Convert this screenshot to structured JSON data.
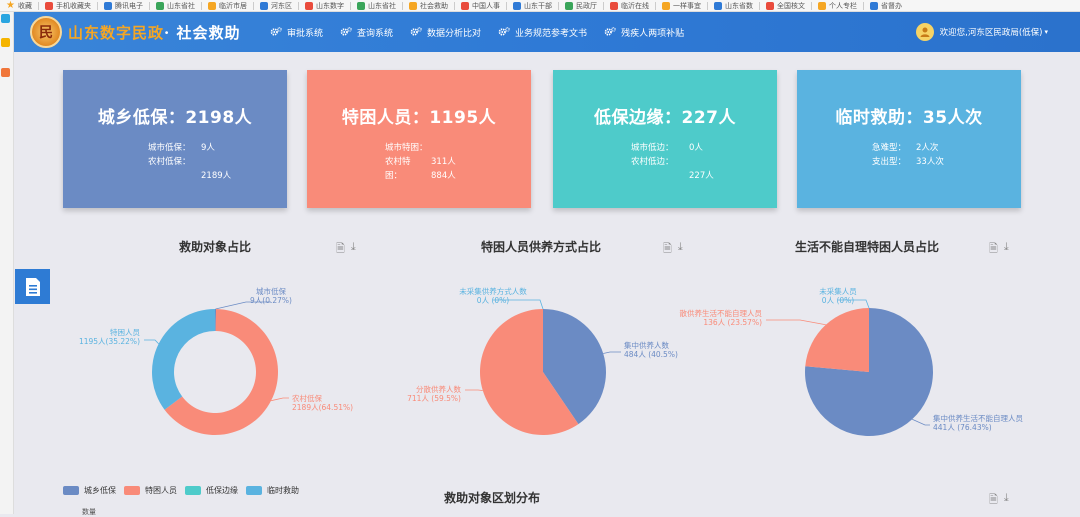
{
  "bookmarks": [
    "收藏",
    "手机收藏夹",
    "腾讯电子",
    "山东省社",
    "临沂市居",
    "河东区",
    "山东数字",
    "山东省社",
    "社会救助",
    "中国人事",
    "山东干部",
    "民政厅",
    "临沂在线",
    "一样事宜",
    "山东省数",
    "全国核文",
    "个人专栏",
    "省督办"
  ],
  "header": {
    "logo_char": "民",
    "brand": "山东数字民政",
    "brand_sub": "· 社会救助",
    "nav": [
      "审批系统",
      "查询系统",
      "数据分析比对",
      "业务规范参考文书",
      "残疾人两项补贴"
    ],
    "user": "欢迎您,河东区民政局(低保)"
  },
  "cards": [
    {
      "title": "城乡低保：2198人",
      "lines": [
        [
          "城市低保：",
          "9人"
        ],
        [
          "农村低保：",
          ""
        ],
        [
          "",
          "2189人"
        ]
      ]
    },
    {
      "title": "特困人员：1195人",
      "lines": [
        [
          "城市特困：",
          ""
        ],
        [
          "农村特",
          "311人"
        ],
        [
          "困：",
          "884人"
        ]
      ]
    },
    {
      "title": "低保边缘：227人",
      "lines": [
        [
          "城市低边：",
          "0人"
        ],
        [
          "农村低边：",
          ""
        ],
        [
          "",
          "227人"
        ]
      ]
    },
    {
      "title": "临时救助：35人次",
      "lines": [
        [
          "急难型：",
          "2人次"
        ],
        [
          "支出型：",
          "33人次"
        ]
      ]
    }
  ],
  "sections": {
    "s1": "救助对象占比",
    "s2": "特困人员供养方式占比",
    "s3": "生活不能自理特困人员占比",
    "s4": "救助对象区划分布"
  },
  "legend": [
    {
      "name": "城乡低保",
      "color": "#6b8bc4"
    },
    {
      "name": "特困人员",
      "color": "#f98b79"
    },
    {
      "name": "低保边缘",
      "color": "#4ecbca"
    },
    {
      "name": "临时救助",
      "color": "#5ab3e0"
    }
  ],
  "bottom_stub": "数量",
  "chart_data": [
    {
      "type": "pie",
      "title": "救助对象占比",
      "donut": true,
      "slices": [
        {
          "label": "城市低保",
          "value": 9,
          "percent": "0.27%",
          "color": "#6b8bc4",
          "text1": "城市低保",
          "text2": "9人(0.27%)"
        },
        {
          "label": "农村低保",
          "value": 2189,
          "percent": "64.51%",
          "color": "#f98b79",
          "text1": "农村低保",
          "text2": "2189人(64.51%)"
        },
        {
          "label": "特困人员",
          "value": 1195,
          "percent": "35.22%",
          "color": "#5ab3e0",
          "text1": "特困人员",
          "text2": "1195人(35.22%)"
        }
      ]
    },
    {
      "type": "pie",
      "title": "特困人员供养方式占比",
      "donut": false,
      "slices": [
        {
          "label": "未采集供养方式人数",
          "value": 0,
          "percent": "0%",
          "color": "#5ab3e0",
          "text1": "未采集供养方式人数",
          "text2": "0人 (0%)"
        },
        {
          "label": "集中供养人数",
          "value": 484,
          "percent": "40.5%",
          "color": "#6b8bc4",
          "text1": "集中供养人数",
          "text2": "484人 (40.5%)"
        },
        {
          "label": "分散供养人数",
          "value": 711,
          "percent": "59.5%",
          "color": "#f98b79",
          "text1": "分散供养人数",
          "text2": "711人 (59.5%)"
        }
      ]
    },
    {
      "type": "pie",
      "title": "生活不能自理特困人员占比",
      "donut": false,
      "slices": [
        {
          "label": "未采集人员",
          "value": 0,
          "percent": "0%",
          "color": "#5ab3e0",
          "text1": "未采集人员",
          "text2": "0人 (0%)"
        },
        {
          "label": "集中供养生活不能自理人员",
          "value": 441,
          "percent": "76.43%",
          "color": "#6b8bc4",
          "text1": "集中供养生活不能自理人员",
          "text2": "441人 (76.43%)"
        },
        {
          "label": "散供养生活不能自理人员",
          "value": 136,
          "percent": "23.57%",
          "color": "#f98b79",
          "text1": "散供养生活不能自理人员",
          "text2": "136人 (23.57%)"
        }
      ]
    }
  ]
}
